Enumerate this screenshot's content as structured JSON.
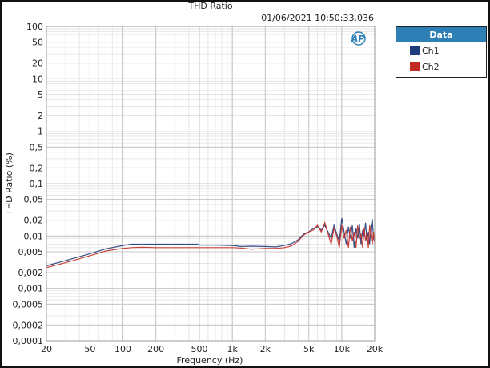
{
  "chart_data": {
    "type": "line",
    "title": "THD Ratio",
    "timestamp": "01/06/2021 10:50:33.036",
    "xlabel": "Frequency (Hz)",
    "ylabel": "THD Ratio (%)",
    "xscale": "log",
    "yscale": "log",
    "xlim": [
      20,
      20000
    ],
    "ylim": [
      0.0001,
      100
    ],
    "grid": true,
    "x_ticks": [
      20,
      50,
      100,
      200,
      500,
      1000,
      2000,
      5000,
      10000,
      20000
    ],
    "x_tick_labels": [
      "20",
      "50",
      "100",
      "200",
      "500",
      "1k",
      "2k",
      "5k",
      "10k",
      "20k"
    ],
    "y_ticks": [
      100,
      50,
      20,
      10,
      5,
      2,
      1,
      0.5,
      0.2,
      0.1,
      0.05,
      0.02,
      0.01,
      0.005,
      0.002,
      0.001,
      0.0005,
      0.0002,
      0.0001
    ],
    "y_tick_labels": [
      "100",
      "50",
      "20",
      "10",
      "5",
      "2",
      "1",
      "0,5",
      "0,2",
      "0,1",
      "0,05",
      "0,02",
      "0,01",
      "0,005",
      "0,002",
      "0,001",
      "0,0005",
      "0,0002",
      "0,0001"
    ],
    "legend": {
      "title": "Data",
      "placement": "right-outside"
    },
    "series": [
      {
        "name": "Ch1",
        "color": "#1f3c7a",
        "x": [
          20,
          30,
          50,
          70,
          100,
          120,
          150,
          200,
          300,
          480,
          500,
          700,
          1000,
          1200,
          1500,
          2000,
          2500,
          3000,
          3500,
          4000,
          4500,
          5000,
          5500,
          6000,
          6500,
          7000,
          7500,
          8000,
          8500,
          9000,
          9500,
          10000,
          10500,
          11000,
          11500,
          12000,
          12500,
          13000,
          13500,
          14000,
          14500,
          15000,
          15500,
          16000,
          16500,
          17000,
          17500,
          18000,
          18500,
          19000,
          19500,
          20000
        ],
        "y": [
          0.0027,
          0.0034,
          0.0046,
          0.0057,
          0.0066,
          0.007,
          0.007,
          0.007,
          0.007,
          0.007,
          0.0067,
          0.0067,
          0.0066,
          0.0063,
          0.0064,
          0.0063,
          0.0062,
          0.0066,
          0.0072,
          0.0085,
          0.011,
          0.012,
          0.014,
          0.015,
          0.013,
          0.016,
          0.012,
          0.009,
          0.016,
          0.011,
          0.008,
          0.022,
          0.012,
          0.007,
          0.015,
          0.009,
          0.016,
          0.006,
          0.014,
          0.009,
          0.017,
          0.007,
          0.013,
          0.01,
          0.018,
          0.008,
          0.012,
          0.007,
          0.015,
          0.021,
          0.009,
          0.008
        ]
      },
      {
        "name": "Ch2",
        "color": "#c42a24",
        "x": [
          20,
          30,
          50,
          70,
          100,
          120,
          150,
          200,
          300,
          500,
          700,
          1000,
          1200,
          1500,
          2000,
          2500,
          3000,
          3500,
          4000,
          4500,
          5000,
          5500,
          6000,
          6500,
          7000,
          7500,
          8000,
          8500,
          9000,
          9500,
          10000,
          10500,
          11000,
          11500,
          12000,
          12500,
          13000,
          13500,
          14000,
          14500,
          15000,
          15500,
          16000,
          16500,
          17000,
          17500,
          18000,
          18500,
          19000,
          19500,
          20000
        ],
        "y": [
          0.0025,
          0.0031,
          0.0042,
          0.0052,
          0.0058,
          0.006,
          0.0061,
          0.006,
          0.006,
          0.006,
          0.006,
          0.006,
          0.0059,
          0.0056,
          0.0058,
          0.0058,
          0.006,
          0.0065,
          0.008,
          0.0105,
          0.012,
          0.013,
          0.016,
          0.012,
          0.018,
          0.011,
          0.007,
          0.014,
          0.01,
          0.006,
          0.016,
          0.009,
          0.013,
          0.006,
          0.015,
          0.008,
          0.012,
          0.006,
          0.016,
          0.009,
          0.011,
          0.006,
          0.014,
          0.008,
          0.012,
          0.006,
          0.016,
          0.01,
          0.007,
          0.012,
          0.007
        ]
      }
    ]
  }
}
